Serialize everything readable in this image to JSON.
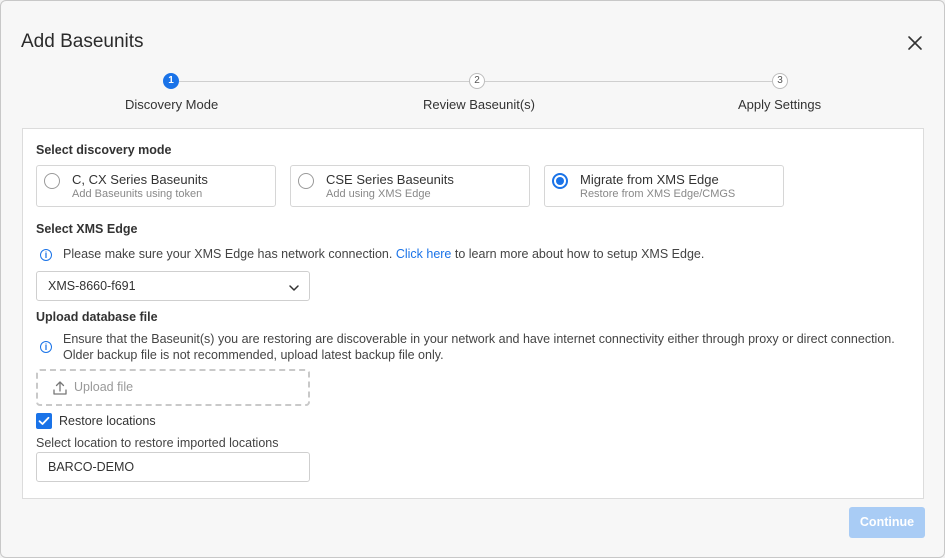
{
  "dialog": {
    "title": "Add Baseunits"
  },
  "stepper": {
    "steps": [
      {
        "number": "1",
        "label": "Discovery Mode"
      },
      {
        "number": "2",
        "label": "Review Baseunit(s)"
      },
      {
        "number": "3",
        "label": "Apply Settings"
      }
    ],
    "active_step": 1
  },
  "discovery": {
    "title": "Select discovery mode",
    "options": [
      {
        "title": "C, CX Series Baseunits",
        "subtitle": "Add Baseunits using token",
        "selected": false
      },
      {
        "title": "CSE Series Baseunits",
        "subtitle": "Add using XMS Edge",
        "selected": false
      },
      {
        "title": "Migrate from XMS Edge",
        "subtitle": "Restore from XMS Edge/CMGS",
        "selected": true
      }
    ]
  },
  "xms_edge": {
    "title": "Select XMS Edge",
    "info_before": "Please make sure your XMS Edge has network connection. ",
    "info_link": "Click here",
    "info_after": " to learn more about how to setup XMS Edge.",
    "selected": "XMS-8660-f691"
  },
  "upload": {
    "title": "Upload database file",
    "info_line1": "Ensure that the Baseunit(s) you are restoring are discoverable in your network and have internet connectivity either through proxy or direct connection.",
    "info_line2": "Older backup file is not recommended, upload latest backup file only.",
    "button_label": "Upload file"
  },
  "restore": {
    "checkbox_label": "Restore locations",
    "checked": true,
    "location_label": "Select location to restore imported locations",
    "location_value": "BARCO-DEMO"
  },
  "footer": {
    "continue_label": "Continue"
  },
  "colors": {
    "accent": "#1a73e8",
    "disabled_button": "#a9ccf5"
  }
}
